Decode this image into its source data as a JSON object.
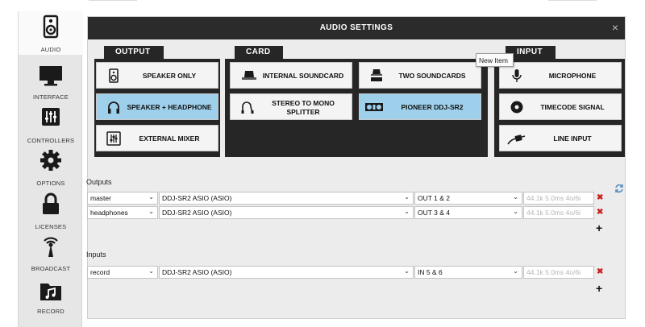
{
  "sidebar": {
    "items": [
      {
        "label": "AUDIO",
        "icon": "speaker-icon"
      },
      {
        "label": "INTERFACE",
        "icon": "monitor-icon"
      },
      {
        "label": "CONTROLLERS",
        "icon": "mixer-sliders-icon"
      },
      {
        "label": "OPTIONS",
        "icon": "gear-icon"
      },
      {
        "label": "LICENSES",
        "icon": "padlock-icon"
      },
      {
        "label": "BROADCAST",
        "icon": "broadcast-icon"
      },
      {
        "label": "RECORD",
        "icon": "music-folder-icon"
      }
    ]
  },
  "window": {
    "title": "AUDIO SETTINGS",
    "close": "×"
  },
  "panels": {
    "output": {
      "tab": "OUTPUT",
      "buttons": [
        {
          "label": "SPEAKER ONLY",
          "icon": "speaker-icon",
          "selected": false
        },
        {
          "label": "SPEAKER + HEADPHONE",
          "icon": "headphones-icon",
          "selected": true
        },
        {
          "label": "EXTERNAL MIXER",
          "icon": "mixer-icon",
          "selected": false
        }
      ]
    },
    "card": {
      "tab": "CARD",
      "buttons": [
        {
          "label": "INTERNAL SOUNDCARD",
          "icon": "laptop-icon",
          "selected": false
        },
        {
          "label": "TWO SOUNDCARDS",
          "icon": "two-soundcards-icon",
          "selected": false
        },
        {
          "label": "STEREO TO MONO SPLITTER",
          "icon": "splitter-cable-icon",
          "selected": false
        },
        {
          "label": "PIONEER DDJ-SR2",
          "icon": "controller-icon",
          "selected": true
        }
      ]
    },
    "input": {
      "tab": "INPUT",
      "buttons": [
        {
          "label": "MICROPHONE",
          "icon": "microphone-icon",
          "selected": false
        },
        {
          "label": "TIMECODE SIGNAL",
          "icon": "vinyl-icon",
          "selected": false
        },
        {
          "label": "LINE INPUT",
          "icon": "line-cable-icon",
          "selected": false
        }
      ]
    }
  },
  "tooltip": "New Item",
  "outputs": {
    "label": "Outputs",
    "rows": [
      {
        "channel": "master",
        "device": "DDJ-SR2 ASIO (ASIO)",
        "port": "OUT 1 & 2",
        "info": "44.1k 5.0ms 4o/6i"
      },
      {
        "channel": "headphones",
        "device": "DDJ-SR2 ASIO (ASIO)",
        "port": "OUT 3 & 4",
        "info": "44.1k 5.0ms 4o/6i"
      }
    ]
  },
  "inputs": {
    "label": "Inputs",
    "rows": [
      {
        "channel": "record",
        "device": "DDJ-SR2 ASIO (ASIO)",
        "port": "IN 5 & 6",
        "info": "44.1k 5.0ms 4o/6i"
      }
    ]
  },
  "glyphs": {
    "chevron": "⌄",
    "remove": "✖",
    "add": "+"
  },
  "colors": {
    "selected": "#9ed0ec",
    "remove": "#cc2020",
    "panel": "#262626"
  }
}
